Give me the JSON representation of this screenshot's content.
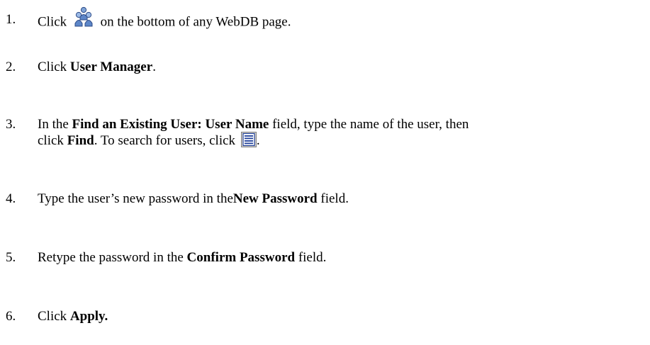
{
  "steps": [
    {
      "num": "1.",
      "pre": "Click ",
      "icon": "users-icon",
      "post": " on the bottom of any WebDB page."
    },
    {
      "num": "2.",
      "pre": "Click ",
      "bold": "User Manager",
      "post": "."
    },
    {
      "num": "3.",
      "pre": "In the ",
      "bold": "Find an Existing User: User Name",
      "post": " field, type the name of the user, then",
      "line2_pre": "click ",
      "line2_bold": "Find",
      "line2_post": ". To search for users, click ",
      "line2_icon": "list-icon",
      "line2_end": "."
    },
    {
      "num": "4.",
      "pre": "Type the user’s new password in the",
      "bold": "New Password",
      "post": " field."
    },
    {
      "num": "5.",
      "pre": "Retype the password in the ",
      "bold": "Confirm Password",
      "post": " field."
    },
    {
      "num": "6.",
      "pre": "Click ",
      "bold": "Apply."
    }
  ]
}
